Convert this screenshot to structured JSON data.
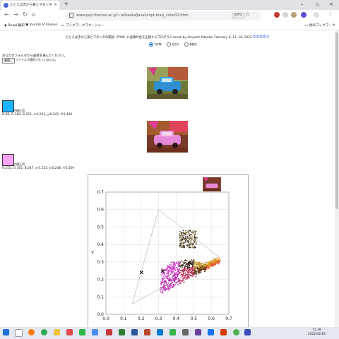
{
  "browser": {
    "tab_title": "たとえば赤から黄とマゼンタの範囲",
    "url": "www.psy.ritsumei.ac.jp/~akitaoka/JavaScript-biasj_color02.html",
    "zoom": "67%",
    "bookmarks": [
      "DeepL翻訳",
      "Journal of Illusion",
      "ブックマークマネージャー"
    ],
    "other_bookmarks": "他のブックマーク"
  },
  "page": {
    "heading": "たとえば赤から黄とマゼンタの範囲（RYM）に画像の色を圧縮するプログラム made by Akiyoshi Kitaoka, February 6, 11, 18, 2022",
    "counter": "000003",
    "radio_options": [
      "RYM",
      "GCY",
      "BMC"
    ],
    "selected_radio": "RYM",
    "file_prompt": "あなたのフォルダから画像を選んでください。",
    "file_button": "参照...",
    "file_status": "ファイルが選択されていません。",
    "original_label": "色補正用",
    "original_values": "R:28, G:180, B:255, x:0.202, y:0.241, Y:0.439",
    "processed_label": "色補正用",
    "processed_values": "R:255, G:165, B:247, x:0.323, y:0.248, Y:0.549",
    "original_swatch_color": "#1cb4ff",
    "processed_swatch_color": "#ffa5f7"
  },
  "chart_data": {
    "type": "scatter",
    "xlabel": "",
    "ylabel": "y",
    "xlim": [
      0.0,
      0.7
    ],
    "ylim": [
      0.0,
      0.7
    ],
    "x_ticks": [
      "0.0",
      "0.1",
      "0.2",
      "0.3",
      "0.4",
      "0.5",
      "0.6",
      "0.7"
    ],
    "y_ticks": [
      "0.0",
      "0.1",
      "0.2",
      "0.3",
      "0.4",
      "0.5",
      "0.6",
      "0.7"
    ],
    "grid": true,
    "gamut_triangle": [
      [
        0.64,
        0.33
      ],
      [
        0.3,
        0.6
      ],
      [
        0.15,
        0.06
      ]
    ],
    "markers": [
      {
        "x": 0.202,
        "y": 0.241,
        "symbol": "x"
      },
      {
        "x": 0.323,
        "y": 0.248,
        "symbol": "x"
      }
    ]
  },
  "taskbar": {
    "time": "11:38",
    "date": "2022/02/18"
  },
  "colors": {
    "accent": "#3b5bdb",
    "tab_bar": "#dfe1e5"
  }
}
